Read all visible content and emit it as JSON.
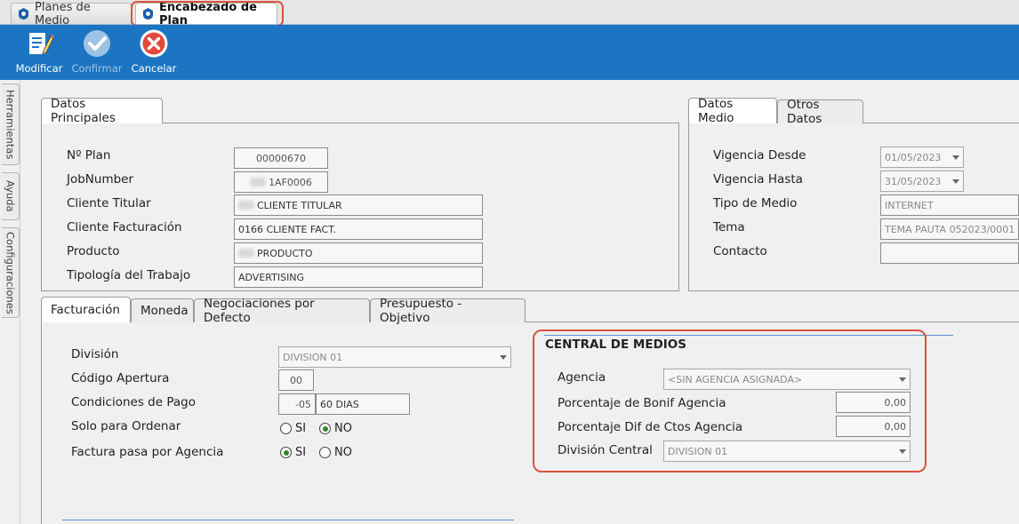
{
  "tabs": [
    {
      "label": "Planes de Medio"
    },
    {
      "label": "Encabezado de Plan"
    }
  ],
  "toolbar": {
    "modificar": "Modificar",
    "confirmar": "Confirmar",
    "cancelar": "Cancelar"
  },
  "side_tabs": [
    "Herramientas",
    "Ayuda",
    "Configuraciones"
  ],
  "datos_principales": {
    "tab": "Datos Principales",
    "nplan_label": "Nº Plan",
    "nplan": "00000670",
    "jobnumber_label": "JobNumber",
    "jobnumber": "1AF0006",
    "cliente_titular_label": "Cliente Titular",
    "cliente_titular": "CLIENTE TITULAR",
    "cliente_fact_label": "Cliente Facturación",
    "cliente_fact": "0166 CLIENTE FACT.",
    "producto_label": "Producto",
    "producto": "PRODUCTO",
    "tipologia_label": "Tipología del Trabajo",
    "tipologia": "ADVERTISING"
  },
  "datos_medio": {
    "tab1": "Datos Medio",
    "tab2": "Otros Datos",
    "vig_desde_label": "Vigencia Desde",
    "vig_desde": "01/05/2023",
    "vig_hasta_label": "Vigencia Hasta",
    "vig_hasta": "31/05/2023",
    "tipo_medio_label": "Tipo de Medio",
    "tipo_medio": "INTERNET",
    "tema_label": "Tema",
    "tema": "TEMA PAUTA 052023/0001",
    "contacto_label": "Contacto",
    "contacto": ""
  },
  "lower_tabs": [
    "Facturación",
    "Moneda",
    "Negociaciones por Defecto",
    "Presupuesto - Objetivo"
  ],
  "facturacion": {
    "division_label": "División",
    "division": "DIVISION 01",
    "codigo_label": "Código Apertura",
    "codigo": "00",
    "condiciones_label": "Condiciones de Pago",
    "condiciones_code": "-05",
    "condiciones_text": "60 DIAS",
    "solo_label": "Solo para Ordenar",
    "factura_label": "Factura pasa por Agencia",
    "si": "SI",
    "no": "NO"
  },
  "central": {
    "title": "CENTRAL DE MEDIOS",
    "agencia_label": "Agencia",
    "agencia": "<SIN AGENCIA ASIGNADA>",
    "bonif_label": "Porcentaje de Bonif Agencia",
    "bonif": "0,00",
    "dif_label": "Porcentaje Dif de Ctos Agencia",
    "dif": "0,00",
    "division_central_label": "División Central",
    "division_central": "DIVISION 01"
  },
  "colors": {
    "accent": "#1b75c3",
    "highlight": "#d9533f"
  }
}
